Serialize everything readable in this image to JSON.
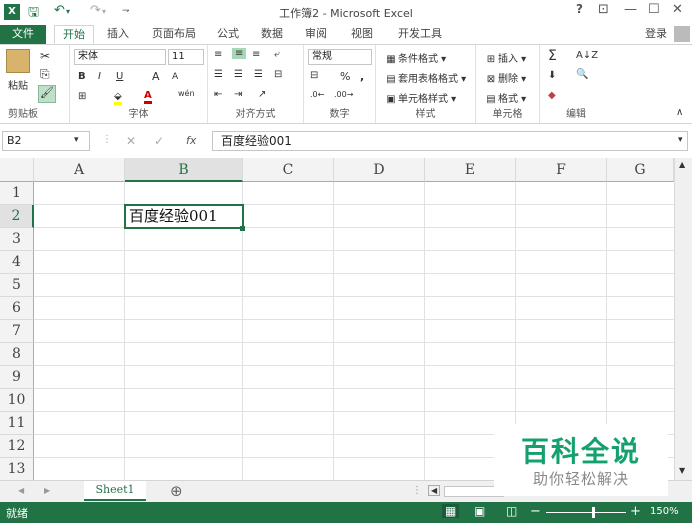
{
  "titlebar": {
    "title": "工作簿2 - Microsoft Excel",
    "logo_letter": "X",
    "help": "?",
    "controls": [
      "⊡",
      "—",
      "☐",
      "✕"
    ]
  },
  "tabs": {
    "file": "文件",
    "items": [
      "开始",
      "插入",
      "页面布局",
      "公式",
      "数据",
      "审阅",
      "视图",
      "开发工具"
    ],
    "login": "登录"
  },
  "ribbon": {
    "clipboard": {
      "label": "剪贴板",
      "paste": "粘贴"
    },
    "font": {
      "label": "字体",
      "name": "宋体",
      "size": "11",
      "bold": "B",
      "italic": "I",
      "underline": "U",
      "grow": "A",
      "shrink": "A",
      "phonetic": "wén"
    },
    "alignment": {
      "label": "对齐方式"
    },
    "number": {
      "label": "数字",
      "format": "常规",
      "percent": "%",
      "comma": ","
    },
    "styles": {
      "label": "样式",
      "cond": "条件格式",
      "table": "套用表格格式",
      "cell": "单元格样式"
    },
    "cells": {
      "label": "单元格",
      "insert": "插入",
      "delete": "删除",
      "format": "格式"
    },
    "editing": {
      "label": "编辑",
      "sum": "Σ"
    }
  },
  "formula_bar": {
    "name_box": "B2",
    "fx": "fx",
    "content": "百度经验001"
  },
  "grid": {
    "columns": [
      "A",
      "B",
      "C",
      "D",
      "E",
      "F",
      "G"
    ],
    "rows": [
      "1",
      "2",
      "3",
      "4",
      "5",
      "6",
      "7",
      "8",
      "9",
      "10",
      "11",
      "12",
      "13"
    ],
    "selected_cell_value": "百度经验001"
  },
  "sheets": {
    "tabs": [
      "Sheet1"
    ],
    "add": "⊕"
  },
  "status": {
    "ready": "就绪",
    "zoom": "150%"
  },
  "watermark": {
    "title": "百科全说",
    "subtitle": "助你轻松解决"
  },
  "colors": {
    "accent": "#217346",
    "watermark": "#14a16e"
  }
}
